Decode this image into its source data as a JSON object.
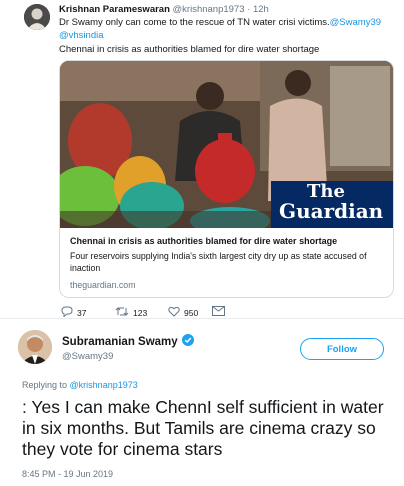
{
  "quoted": {
    "author_name": "Krishnan Parameswaran",
    "author_handle": "@krishnanp1973",
    "time": "12h",
    "text_prefix": "Dr Swamy only can come to the rescue of TN water crisi victims.",
    "mention_1": "@Swamy39",
    "mention_2": "@vhsindia",
    "headline": "Chennai in crisis as authorities blamed for dire water shortage",
    "card": {
      "brand_line1": "The",
      "brand_line2": "Guardian",
      "title": "Chennai in crisis as authorities blamed for dire water shortage",
      "description": "Four reservoirs supplying India's sixth largest city dry up as state accused of inaction",
      "domain": "theguardian.com"
    },
    "actions": {
      "replies": "37",
      "retweets": "123",
      "likes": "950"
    }
  },
  "tweet": {
    "author_name": "Subramanian Swamy",
    "author_handle": "@Swamy39",
    "follow_label": "Follow",
    "replying_prefix": "Replying to",
    "replying_handle": "@krishnanp1973",
    "text": ": Yes I can make ChennI self sufficient in water in six months. But Tamils are cinema crazy so they vote for cinema stars",
    "timestamp": "8:45 PM - 19 Jun 2019"
  },
  "colors": {
    "link": "#1b95e0",
    "follow": "#1da1f2",
    "brand_bg": "#052962"
  }
}
